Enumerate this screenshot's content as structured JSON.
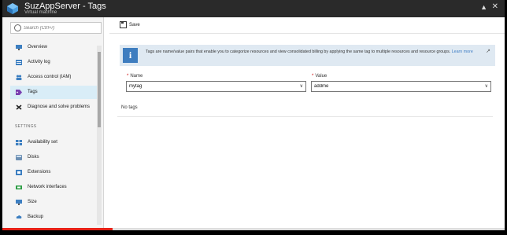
{
  "window": {
    "title": "SuzAppServer - Tags",
    "subtitle": "Virtual machine",
    "pin_icon": "pin-icon",
    "close_icon": "close-icon"
  },
  "sidebar": {
    "search_placeholder": "Search (Ctrl+/)",
    "items": [
      {
        "label": "Overview",
        "icon": "monitor-icon"
      },
      {
        "label": "Activity log",
        "icon": "activity-log-icon"
      },
      {
        "label": "Access control (IAM)",
        "icon": "people-icon"
      },
      {
        "label": "Tags",
        "icon": "tag-icon",
        "active": true
      },
      {
        "label": "Diagnose and solve problems",
        "icon": "wrench-icon"
      }
    ],
    "section_label": "SETTINGS",
    "settings_items": [
      {
        "label": "Availability set",
        "icon": "availability-set-icon"
      },
      {
        "label": "Disks",
        "icon": "disk-icon"
      },
      {
        "label": "Extensions",
        "icon": "extensions-icon"
      },
      {
        "label": "Network interfaces",
        "icon": "network-icon"
      },
      {
        "label": "Size",
        "icon": "monitor-icon"
      },
      {
        "label": "Backup",
        "icon": "backup-icon"
      }
    ]
  },
  "toolbar": {
    "save_label": "Save"
  },
  "info_banner": {
    "text": "Tags are name/value pairs that enable you to categorize resources and view consolidated billing by applying the same tag to multiple resources and resource groups.",
    "link": "Learn more"
  },
  "form": {
    "name_label": "Name",
    "name_value": "mytag",
    "value_label": "Value",
    "value_value": "addme"
  },
  "empty_message": "No tags",
  "video_progress": 0.22,
  "colors": {
    "accent": "#3e7dbf",
    "progress": "#e62117",
    "active_item": "#d9edf7"
  }
}
